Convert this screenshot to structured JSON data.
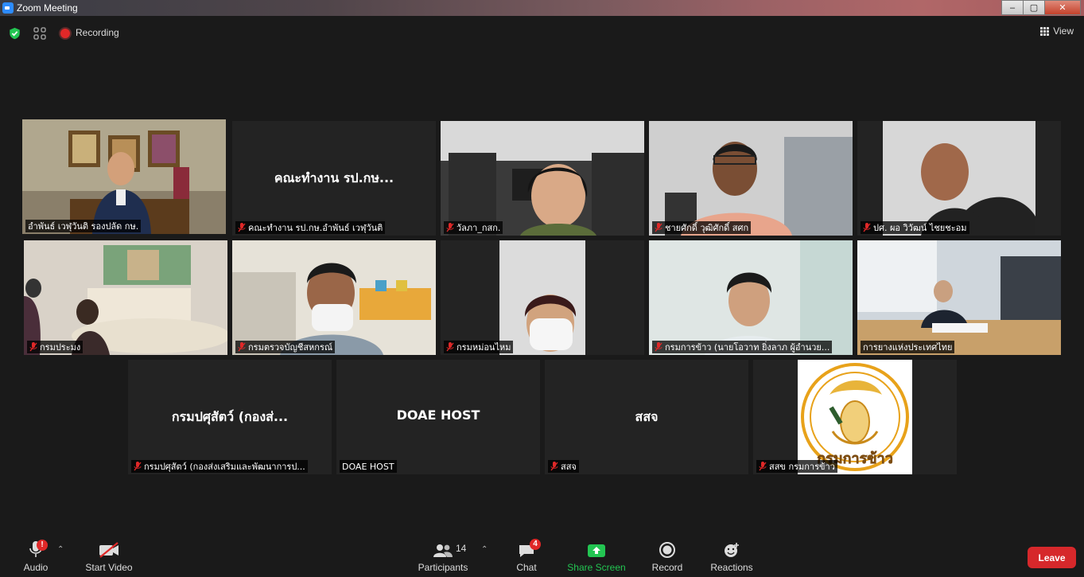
{
  "window": {
    "title": "Zoom Meeting",
    "min": "–",
    "max": "▢",
    "close": "✕"
  },
  "topbar": {
    "recording_label": "Recording",
    "view_label": "View"
  },
  "tiles": [
    {
      "name": "อำพันธ์ เวฬุวันติ รองปลัด กษ.",
      "big": "",
      "muted": false,
      "active": true
    },
    {
      "name": "คณะทำงาน รป.กษ.อำพันธ์ เวฬุวันติ",
      "big": "คณะทำงาน รป.กษ...",
      "muted": true,
      "active": false
    },
    {
      "name": "วัลภา_กสก.",
      "big": "",
      "muted": true,
      "active": false
    },
    {
      "name": "ชายศักดิ์ วุฒิศักดิ์ สศก",
      "big": "",
      "muted": true,
      "active": false
    },
    {
      "name": "ปศ. ผอ วิวัฒน์ ไชยชะอม",
      "big": "",
      "muted": true,
      "active": false
    },
    {
      "name": "กรมประมง",
      "big": "",
      "muted": true,
      "active": false
    },
    {
      "name": "กรมตรวจบัญชีสหกรณ์",
      "big": "",
      "muted": true,
      "active": false
    },
    {
      "name": "กรมหม่อนไหม",
      "big": "",
      "muted": true,
      "active": false
    },
    {
      "name": "กรมการข้าว (นายโอวาท ยิ่งลาภ ผู้อำนวย...",
      "big": "",
      "muted": true,
      "active": false
    },
    {
      "name": "การยางแห่งประเทศไทย",
      "big": "",
      "muted": false,
      "active": false
    },
    {
      "name": "กรมปศุสัตว์ (กองส่งเสริมและพัฒนาการป...",
      "big": "กรมปศุสัตว์ (กองส่...",
      "muted": true,
      "active": false
    },
    {
      "name": "DOAE HOST",
      "big": "DOAE HOST",
      "muted": false,
      "active": false
    },
    {
      "name": "สสจ",
      "big": "สสจ",
      "muted": true,
      "active": false
    },
    {
      "name": "สสข กรมการข้าว",
      "big": "",
      "muted": true,
      "active": false
    }
  ],
  "logo_text": "กรมการข้าว",
  "toolbar": {
    "audio": "Audio",
    "audio_alert": "!",
    "video": "Start Video",
    "participants": "Participants",
    "participants_count": "14",
    "chat": "Chat",
    "chat_badge": "4",
    "share": "Share Screen",
    "record": "Record",
    "reactions": "Reactions",
    "leave": "Leave"
  },
  "colors": {
    "accent_green": "#23c552",
    "leave_red": "#d6282b",
    "active_border": "#c8e04a"
  }
}
